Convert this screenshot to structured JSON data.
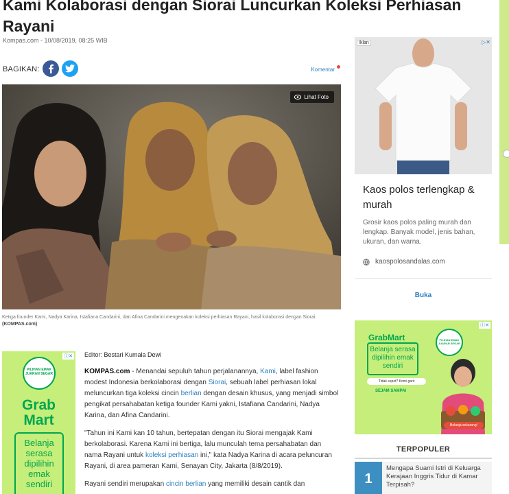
{
  "article": {
    "title": "Kami Kolaborasi dengan Siorai Luncurkan Koleksi Perhiasan Rayani",
    "source_date": "Kompas.com - 10/08/2019, 08:25 WIB",
    "share_label": "BAGIKAN:",
    "komentar_label": "Komentar",
    "lihat_foto_label": "Lihat Foto",
    "caption_text": "Ketiga founder Kami, Nadya Karina, Istafiana Candarini, dan Afina Candarini mengenakan koleksi perhiasan Rayani, hasil kolaborasi dengan Siorai.",
    "caption_credit": "(KOMPAS.com)",
    "editor_label": "Editor:",
    "editor_name": "Bestari Kumala Dewi",
    "p1": {
      "lead": "KOMPAS.com",
      "t1": " - Menandai sepuluh tahun perjalanannya, ",
      "link1": "Kami",
      "t2": ", label fashion modest Indonesia berkolaborasi dengan ",
      "link2": "Siorai",
      "t3": ", sebuah label perhiasan lokal meluncurkan tiga koleksi cincin ",
      "link3": "berlian",
      "t4": " dengan desain khusus, yang menjadi simbol pengikat persahabatan ketiga founder Kami yakni, Istafiana Candarini, Nadya Karina, dan Afina Candarini."
    },
    "p2": {
      "t1": "\"Tahun ini Kami kan 10 tahun, bertepatan dengan itu Siorai mengajak Kami berkolaborasi. Karena Kami ini bertiga, lalu munculah tema persahabatan dan nama Rayani untuk ",
      "link1": "koleksi perhiasan",
      "t2": " ini,\" kata Nadya Karina di acara peluncuran Rayani, di area pameran Kami, Senayan City, Jakarta (8/8/2019)."
    },
    "p3": {
      "t1": "Rayani sendiri merupakan ",
      "link1": "cincin berlian",
      "t2": " yang memiliki desain cantik dan"
    }
  },
  "ad_left": {
    "badge": "PILIHAN EMAK JUARAN SEGAR",
    "brand_line1": "Grab",
    "brand_line2": "Mart",
    "slogan": "Belanja serasa dipilihin emak sendiri"
  },
  "ad_right": {
    "iklan_label": "Iklan",
    "close_label": "▷✕",
    "title": "Kaos polos terlengkap & murah",
    "description": "Grosir kaos polos paling murah dan lengkap. Banyak model, jenis bahan, ukuran, dan warna.",
    "domain": "kaospolosandalas.com",
    "cta": "Buka"
  },
  "ad_grab": {
    "brand": "GrabMart",
    "slogan": "Belanja serasa dipilihin emak sendiri",
    "pill": "Tidak sepot? Komi garit",
    "sub": "SEJAM SAMPAI",
    "badge": "PILIHAN EMAK JUARAN SEGAR",
    "cta": "Belanja sekarang!"
  },
  "terpopuler": {
    "title": "TERPOPULER",
    "items": [
      {
        "rank": "1",
        "text": "Mengapa Suami Istri di Keluarga Kerajaan Inggris Tidur di Kamar Terpisah?"
      }
    ]
  },
  "colors": {
    "link": "#2a7fc0",
    "facebook": "#3b5998",
    "twitter": "#1da1f2",
    "grab_green": "#00a650",
    "grab_bg": "#c6ee7a",
    "rank_blue": "#3e8fc1"
  },
  "icons": {
    "facebook": "facebook-icon",
    "twitter": "twitter-icon",
    "eye": "eye-icon",
    "globe": "globe-icon"
  }
}
